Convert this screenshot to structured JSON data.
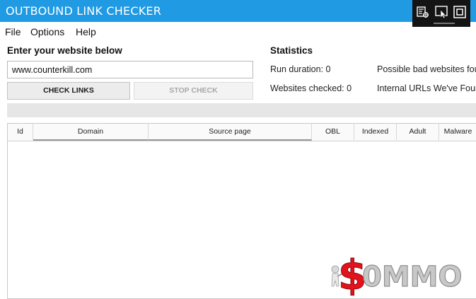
{
  "window": {
    "title": "OUTBOUND LINK CHECKER",
    "devtools_icons": [
      "live-visual-tree-icon",
      "select-element-icon",
      "display-layout-adorners-icon"
    ]
  },
  "menu": {
    "file": "File",
    "options": "Options",
    "help": "Help"
  },
  "input_section": {
    "heading": "Enter your website below",
    "url_value": "www.counterkill.com",
    "check_label": "CHECK LINKS",
    "stop_label": "STOP CHECK"
  },
  "statistics": {
    "heading": "Statistics",
    "run_duration": "Run duration: 0",
    "websites_checked": "Websites checked: 0",
    "possible_bad": "Possible bad websites fou",
    "internal_urls": "Internal URLs We've Found"
  },
  "progress": {
    "value_fraction": 0
  },
  "table": {
    "columns": [
      "Id",
      "Domain",
      "Source page",
      "OBL",
      "Indexed",
      "Adult",
      "Malware"
    ],
    "rows": []
  },
  "watermark": {
    "text": "$0MMO"
  },
  "colors": {
    "titlebar": "#1f9ae3",
    "devtools_bar": "#141414",
    "watermark_red": "#e3121b",
    "watermark_gray": "#c8c8c8"
  }
}
